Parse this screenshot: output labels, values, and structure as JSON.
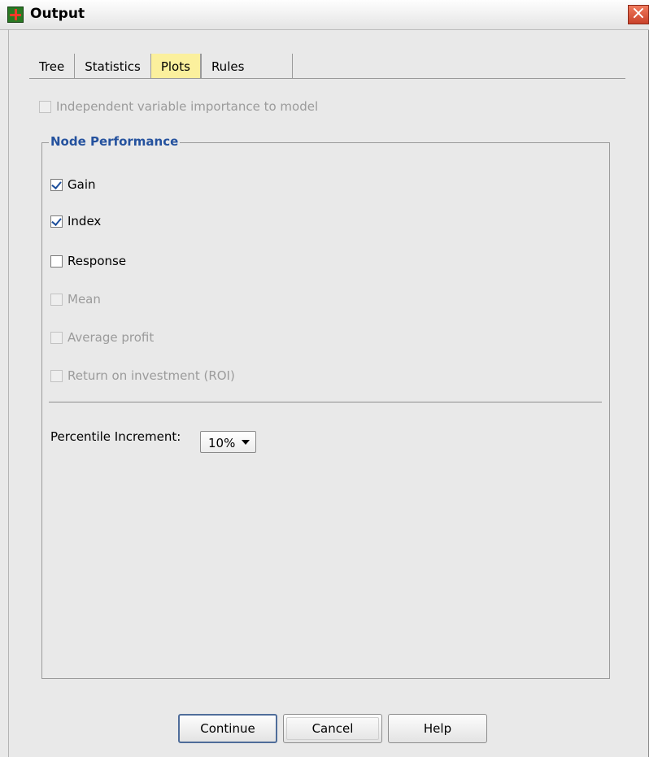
{
  "window": {
    "title": "Output"
  },
  "tabs": [
    {
      "label": "Tree"
    },
    {
      "label": "Statistics"
    },
    {
      "label": "Plots",
      "active": true
    },
    {
      "label": "Rules"
    }
  ],
  "options": {
    "independent_importance": {
      "label": "Independent variable importance to model",
      "checked": false,
      "enabled": false
    }
  },
  "node_performance": {
    "title": "Node Performance",
    "items": [
      {
        "label": "Gain",
        "checked": true,
        "enabled": true
      },
      {
        "label": "Index",
        "checked": true,
        "enabled": true
      },
      {
        "label": "Response",
        "checked": false,
        "enabled": true
      },
      {
        "label": "Mean",
        "checked": false,
        "enabled": false
      },
      {
        "label": "Average profit",
        "checked": false,
        "enabled": false
      },
      {
        "label": "Return on investment (ROI)",
        "checked": false,
        "enabled": false
      }
    ],
    "percentile_label": "Percentile Increment:",
    "percentile_value": "10%"
  },
  "buttons": {
    "continue": "Continue",
    "cancel": "Cancel",
    "help": "Help"
  },
  "colors": {
    "active_tab": "#fbf09d",
    "group_title": "#25529e",
    "close_button": "#d9523a"
  }
}
